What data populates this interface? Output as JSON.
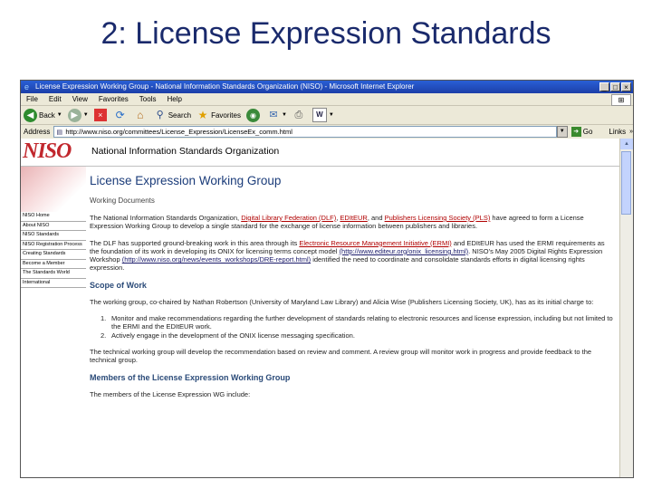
{
  "slide": {
    "title": "2: License Expression Standards"
  },
  "window": {
    "title": "License Expression Working Group - National Information Standards Organization (NISO) - Microsoft Internet Explorer",
    "buttons": [
      "_",
      "□",
      "×"
    ]
  },
  "menu": [
    "File",
    "Edit",
    "View",
    "Favorites",
    "Tools",
    "Help"
  ],
  "toolbar": {
    "back": "Back",
    "search": "Search",
    "favorites": "Favorites"
  },
  "address": {
    "label": "Address",
    "value": "http://www.niso.org/committees/License_Expression/LicenseEx_comm.html",
    "go": "Go",
    "links": "Links"
  },
  "site": {
    "logo": "NISO",
    "org_name": "National Information Standards Organization",
    "nav": [
      "NISO Home",
      "About NISO",
      "NISO Standards",
      "NISO Registration Process",
      "Creating Standards",
      "Become a Member",
      "The Standards World",
      "International"
    ],
    "heading": "License Expression Working Group",
    "sub": "Working Documents",
    "p1_pre": "The National Information Standards Organization, ",
    "p1_link1": "Digital Library Federation (DLF)",
    "p1_mid1": ", ",
    "p1_link2": "EDItEUR",
    "p1_mid2": ", and ",
    "p1_link3": "Publishers Licensing Society (PLS)",
    "p1_post": " have agreed to form a License Expression Working Group to develop a single standard for the exchange of license information between publishers and libraries.",
    "p2_pre": "The DLF has supported ground-breaking work in this area through its ",
    "p2_link1": "Electronic Resource Management Initiative (ERMI)",
    "p2_mid1": " and EDItEUR has used the ERMI requirements as the foundation of its work in developing its ONIX for licensing terms concept model ",
    "p2_link2": "(http://www.editeur.org/onix_licensing.html)",
    "p2_mid2": ". NISO's May 2005 Digital Rights Expression Workshop ",
    "p2_link3": "(http://www.niso.org/news/events_workshops/DRE-report.html)",
    "p2_post": " identified the need to coordinate and consolidate standards efforts in digital licensing rights expression.",
    "h_scope": "Scope of Work",
    "p3": "The working group, co-chaired by Nathan Robertson (University of Maryland Law Library) and Alicia Wise (Publishers Licensing Society, UK), has as its initial charge to:",
    "list": [
      {
        "n": "1.",
        "t": "Monitor and make recommendations regarding the further development of standards relating to electronic resources and license expression, including but not limited to the ERMI and the EDItEUR work."
      },
      {
        "n": "2.",
        "t": "Actively engage in the development of the ONIX license messaging specification."
      }
    ],
    "p4": "The technical working group will develop the recommendation based on review and comment. A review group will monitor work in progress and provide feedback to the technical group.",
    "h_members": "Members of the License Expression Working Group",
    "p5": "The members of the License Expression WG include:"
  }
}
